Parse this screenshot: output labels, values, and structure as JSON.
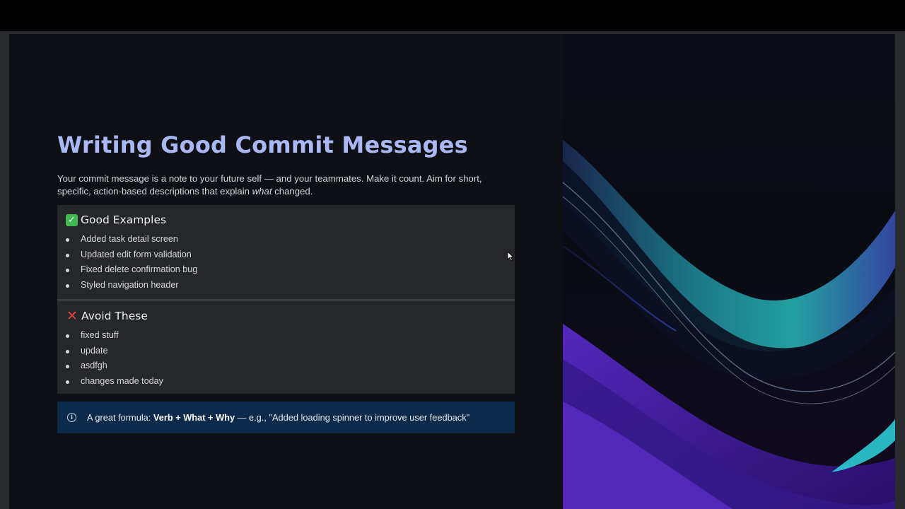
{
  "slide": {
    "title": "Writing Good Commit Messages",
    "intro": {
      "part1": "Your commit message is a note to your future self — and your teammates. Make it count. Aim for short, specific, action-based descriptions that explain ",
      "emphasis": "what",
      "part2": " changed."
    },
    "good": {
      "heading": "Good Examples",
      "icon": "check-mark-icon",
      "items": [
        "Added task detail screen",
        "Updated edit form validation",
        "Fixed delete confirmation bug",
        "Styled navigation header"
      ]
    },
    "avoid": {
      "heading": "Avoid These",
      "icon": "cross-mark-icon",
      "items": [
        "fixed stuff",
        "update",
        "asdfgh",
        "changes made today"
      ]
    },
    "info": {
      "icon": "info-icon",
      "prefix": "A great formula: ",
      "formula": "Verb + What + Why",
      "suffix": " — e.g., \"Added loading spinner to improve user feedback\""
    }
  },
  "colors": {
    "title": "#a9b8f2",
    "card": "#26272b",
    "info_bg": "#0c2a4a",
    "check": "#3fb950",
    "cross": "#e0443e"
  }
}
